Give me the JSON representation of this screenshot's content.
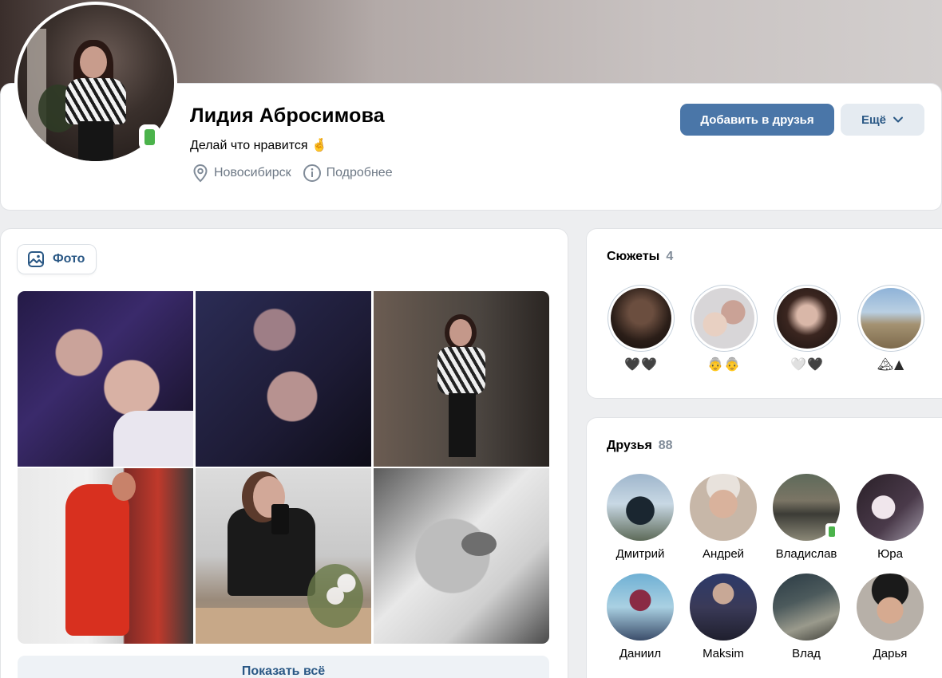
{
  "profile": {
    "name": "Лидия Абросимова",
    "status": "Делай что нравится",
    "status_emoji": "🤞",
    "city": "Новосибирск",
    "details_label": "Подробнее",
    "add_friend_label": "Добавить в друзья",
    "more_label": "Ещё"
  },
  "photos": {
    "tab_label": "Фото",
    "show_all_label": "Показать всё"
  },
  "stories": {
    "title": "Сюжеты",
    "count": "4",
    "items": [
      {
        "caption": "🖤🖤"
      },
      {
        "caption": "👵👵"
      },
      {
        "caption": "🤍🖤"
      },
      {
        "caption": "🏔▲"
      }
    ]
  },
  "friends": {
    "title": "Друзья",
    "count": "88",
    "items": [
      {
        "name": "Дмитрий",
        "online": false
      },
      {
        "name": "Андрей",
        "online": false
      },
      {
        "name": "Владислав",
        "online": true
      },
      {
        "name": "Юра",
        "online": false
      },
      {
        "name": "Даниил",
        "online": false
      },
      {
        "name": "Maksim",
        "online": false
      },
      {
        "name": "Влад",
        "online": false
      },
      {
        "name": "Дарья",
        "online": false
      }
    ]
  },
  "colors": {
    "accent": "#4a76a8",
    "link": "#2a5885",
    "online": "#4bb34b",
    "secondary_text": "#6d7885",
    "background": "#edeef0"
  },
  "icons": [
    "location-pin-icon",
    "info-icon",
    "chevron-down-icon",
    "image-icon",
    "mobile-online-icon"
  ]
}
